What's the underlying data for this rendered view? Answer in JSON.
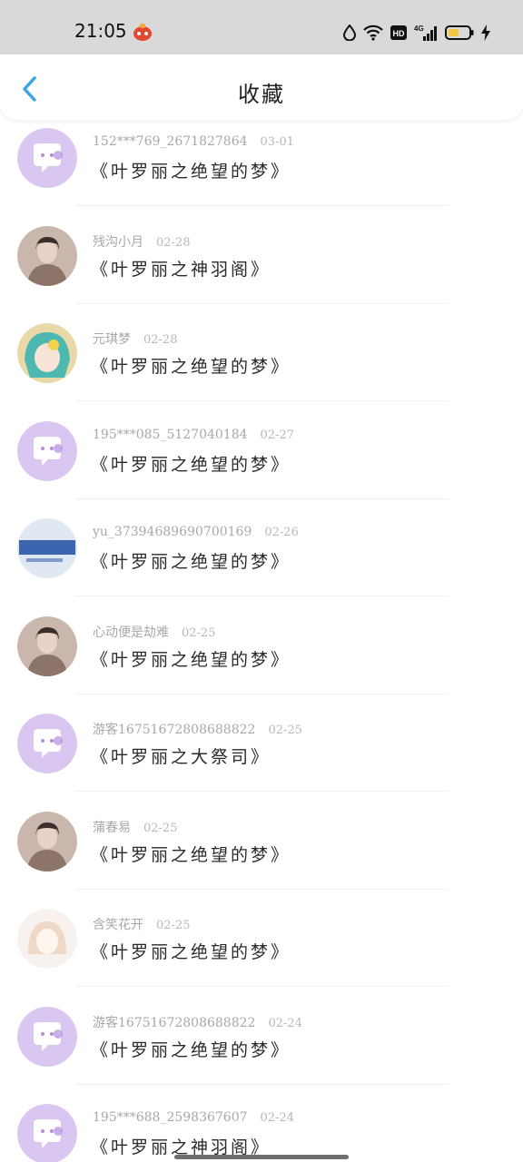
{
  "status_bar": {
    "time": "21:05",
    "icons": [
      "app-notification-icon",
      "data-saver-icon",
      "wifi-icon",
      "hd-icon",
      "signal-4g-icon",
      "battery-icon",
      "charging-icon"
    ],
    "hd_label": "HD",
    "network_label": "4G"
  },
  "header": {
    "title": "收藏",
    "back_icon": "chevron-left-icon",
    "accent_color": "#3aa6e6"
  },
  "avatar_colors": {
    "default_bg": "#d9c7f2",
    "default_glyph": "#ffffff",
    "default_dot": "#b48be0"
  },
  "favorites": [
    {
      "user": "152***769_2671827864",
      "date": "03-01",
      "work": "《叶罗丽之绝望的梦》",
      "avatar": "default-chat-avatar"
    },
    {
      "user": "残沟小月",
      "date": "02-28",
      "work": "《叶罗丽之神羽阁》",
      "avatar": "photo-avatar"
    },
    {
      "user": "元琪梦",
      "date": "02-28",
      "work": "《叶罗丽之绝望的梦》",
      "avatar": "anime-avatar"
    },
    {
      "user": "195***085_5127040184",
      "date": "02-27",
      "work": "《叶罗丽之绝望的梦》",
      "avatar": "default-chat-avatar"
    },
    {
      "user": "yu_3739468969070016​9",
      "date": "02-26",
      "work": "《叶罗丽之绝望的梦》",
      "avatar": "text-image-avatar"
    },
    {
      "user": "心动便是劫难",
      "date": "02-25",
      "work": "《叶罗丽之绝望的梦》",
      "avatar": "photo-avatar"
    },
    {
      "user": "游客16751672808688822",
      "date": "02-25",
      "work": "《叶罗丽之大祭司》",
      "avatar": "default-chat-avatar"
    },
    {
      "user": "蒲春易",
      "date": "02-25",
      "work": "《叶罗丽之绝望的梦》",
      "avatar": "photo-avatar"
    },
    {
      "user": "含笑花开",
      "date": "02-25",
      "work": "《叶罗丽之绝望的梦》",
      "avatar": "anime-sketch-avatar"
    },
    {
      "user": "游客16751672808688822",
      "date": "02-24",
      "work": "《叶罗丽之绝望的梦》",
      "avatar": "default-chat-avatar"
    },
    {
      "user": "195***688_2598367607",
      "date": "02-24",
      "work": "《叶罗丽之神羽阁》",
      "avatar": "default-chat-avatar"
    }
  ]
}
